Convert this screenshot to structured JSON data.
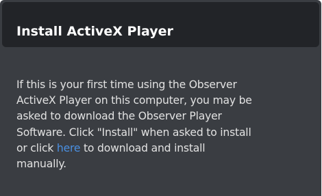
{
  "panel": {
    "title": "Install ActiveX Player",
    "body": {
      "line1": "If this is your first time using the Observer",
      "line2": "ActiveX Player on this computer, you may be",
      "line3": "asked to download the Observer Player",
      "line4": "Software. Click \"Install\" when asked to install",
      "line5_before": "or click ",
      "line5_link": "here",
      "line5_after": " to download and install",
      "line6": "manually."
    }
  },
  "colors": {
    "panel_background": "#3a3d42",
    "header_background": "#222428",
    "title_text": "#ffffff",
    "body_text": "#e2e2e2",
    "link": "#4a90e2"
  }
}
